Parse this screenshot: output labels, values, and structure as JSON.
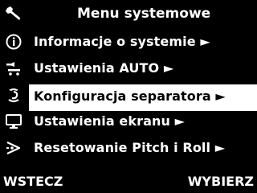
{
  "header": {
    "title": "Menu systemowe",
    "icon": "wrench-icon"
  },
  "menu": {
    "items": [
      {
        "label": "Informacje o systemie ►",
        "icon": "info-icon",
        "selected": false
      },
      {
        "label": "Ustawienia AUTO ►",
        "icon": "auto-settings-icon",
        "selected": false
      },
      {
        "label": "Konfiguracja separatora ►",
        "icon": "separator-icon",
        "selected": true
      },
      {
        "label": "Ustawienia ekranu ►",
        "icon": "monitor-icon",
        "selected": false
      },
      {
        "label": "Resetowanie Pitch i Roll ►",
        "icon": "pitch-roll-icon",
        "selected": false
      }
    ]
  },
  "softkeys": {
    "left": "WSTECZ",
    "right": "WYBIERZ"
  },
  "colors": {
    "background": "#000000",
    "foreground": "#ffffff",
    "selection": "#ffffff",
    "selection_text": "#000000"
  }
}
